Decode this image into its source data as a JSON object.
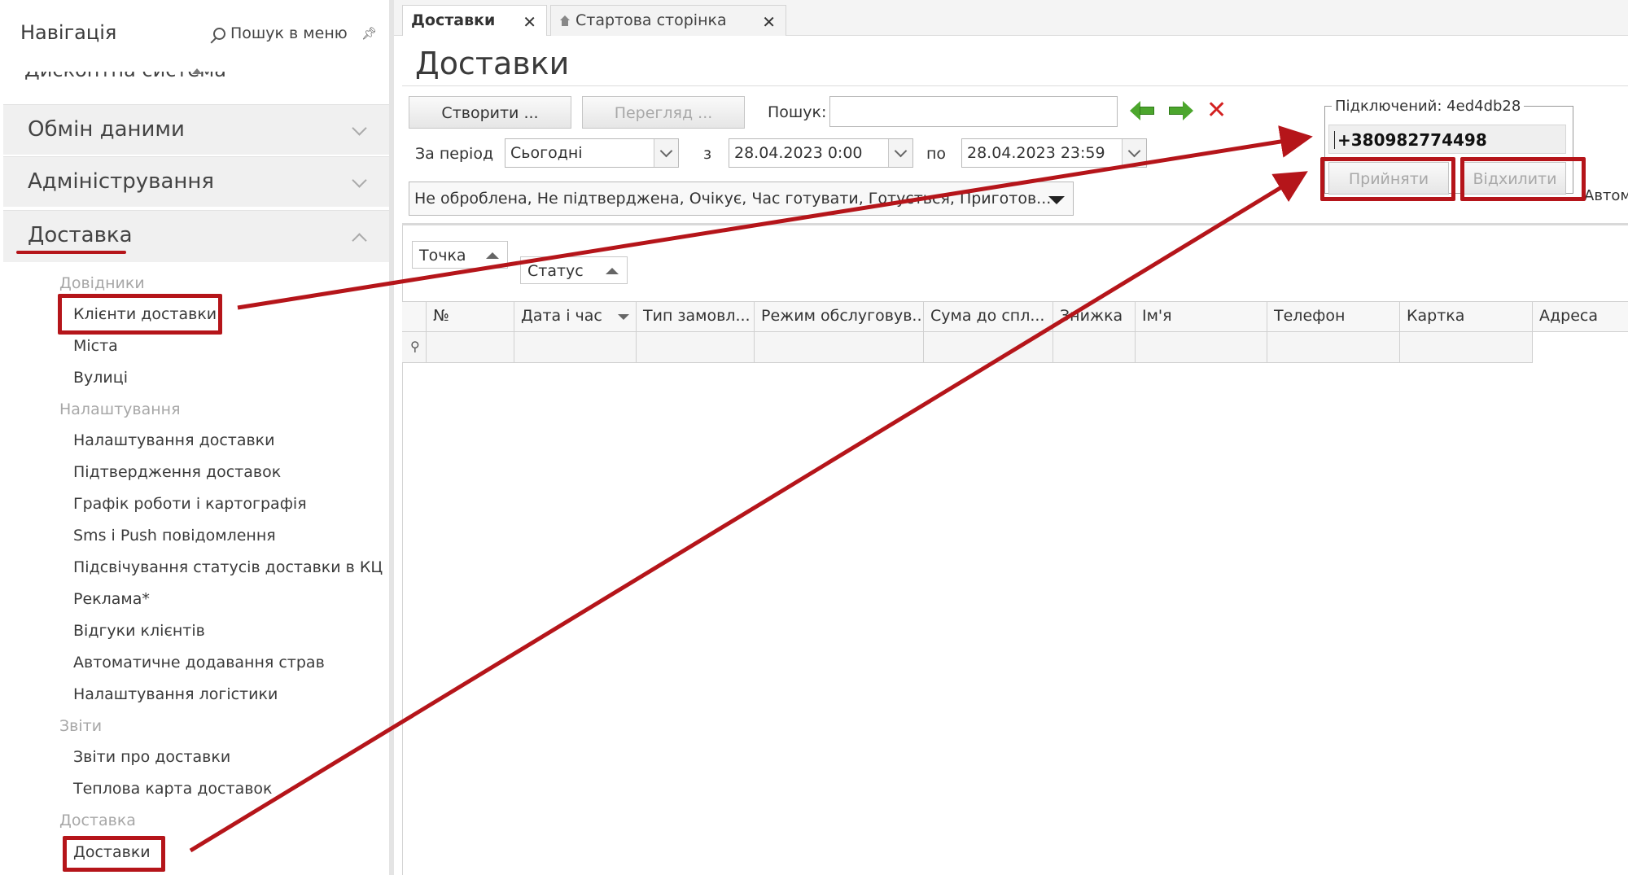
{
  "navigation": {
    "title": "Навігація",
    "search_label": "Пошук в меню",
    "cut_item": "Дисконтна система",
    "sections": [
      {
        "label": "Обмін даними"
      },
      {
        "label": "Адміністрування"
      },
      {
        "label": "Доставка"
      }
    ],
    "groups": {
      "dovidnyky": "Довідники",
      "nalashtuvannya": "Налаштування",
      "zvity": "Звіти",
      "dostavka": "Доставка"
    },
    "items": {
      "klienty": "Клієнти доставки",
      "mista": "Міста",
      "vulytsi": "Вулиці",
      "nalashtuvannya_dostavky": "Налаштування доставки",
      "pidtverdzhennya": "Підтвердження доставок",
      "grafik": "Графік роботи і картографія",
      "sms": "Sms і Push повідомлення",
      "pidsvichuvannya": "Підсвічування статусів доставки в КЦ",
      "reklama": "Реклама*",
      "vidguky": "Відгуки клієнтів",
      "avto_strav": "Автоматичне додавання страв",
      "logistyka": "Налаштування логістики",
      "zvity_dostavky": "Звіти про доставки",
      "teplova": "Теплова карта доставок",
      "dostavky": "Доставки"
    }
  },
  "tabs": [
    {
      "label": "Доставки",
      "active": true
    },
    {
      "label": "Стартова сторінка",
      "active": false
    }
  ],
  "page_title": "Доставки",
  "toolbar": {
    "create": "Створити ...",
    "view": "Перегляд ...",
    "search_label": "Пошук:",
    "search_value": "",
    "period_label": "За період",
    "period_value": "Сьогодні",
    "from_label": "з",
    "from_value": "28.04.2023 0:00",
    "to_label": "по",
    "to_value": "28.04.2023 23:59",
    "status_filter": "Не оброблена, Не підтверджена, Очікує, Час готувати, Готується, Приготов..."
  },
  "connection": {
    "legend": "Підключений: 4ed4db28",
    "phone": "+380982774498",
    "accept": "Прийняти",
    "reject": "Відхилити",
    "auto": "Автом"
  },
  "grouping": {
    "tochka": "Точка",
    "status": "Статус"
  },
  "grid": {
    "columns": [
      "№",
      "Дата і час",
      "Тип замовл...",
      "Режим обслуговув...",
      "Сума до спл...",
      "Знижка",
      "Ім'я",
      "Телефон",
      "Картка",
      "Адреса"
    ]
  },
  "colors": {
    "annotation_red": "#b5151a",
    "nav_arrow_green": "#4ca62d",
    "clear_red": "#d32020"
  },
  "icons": {
    "search": "search-icon",
    "pin": "pin-icon",
    "home": "home-icon",
    "back": "arrow-left-icon",
    "forward": "arrow-right-icon",
    "clear": "close-icon"
  }
}
